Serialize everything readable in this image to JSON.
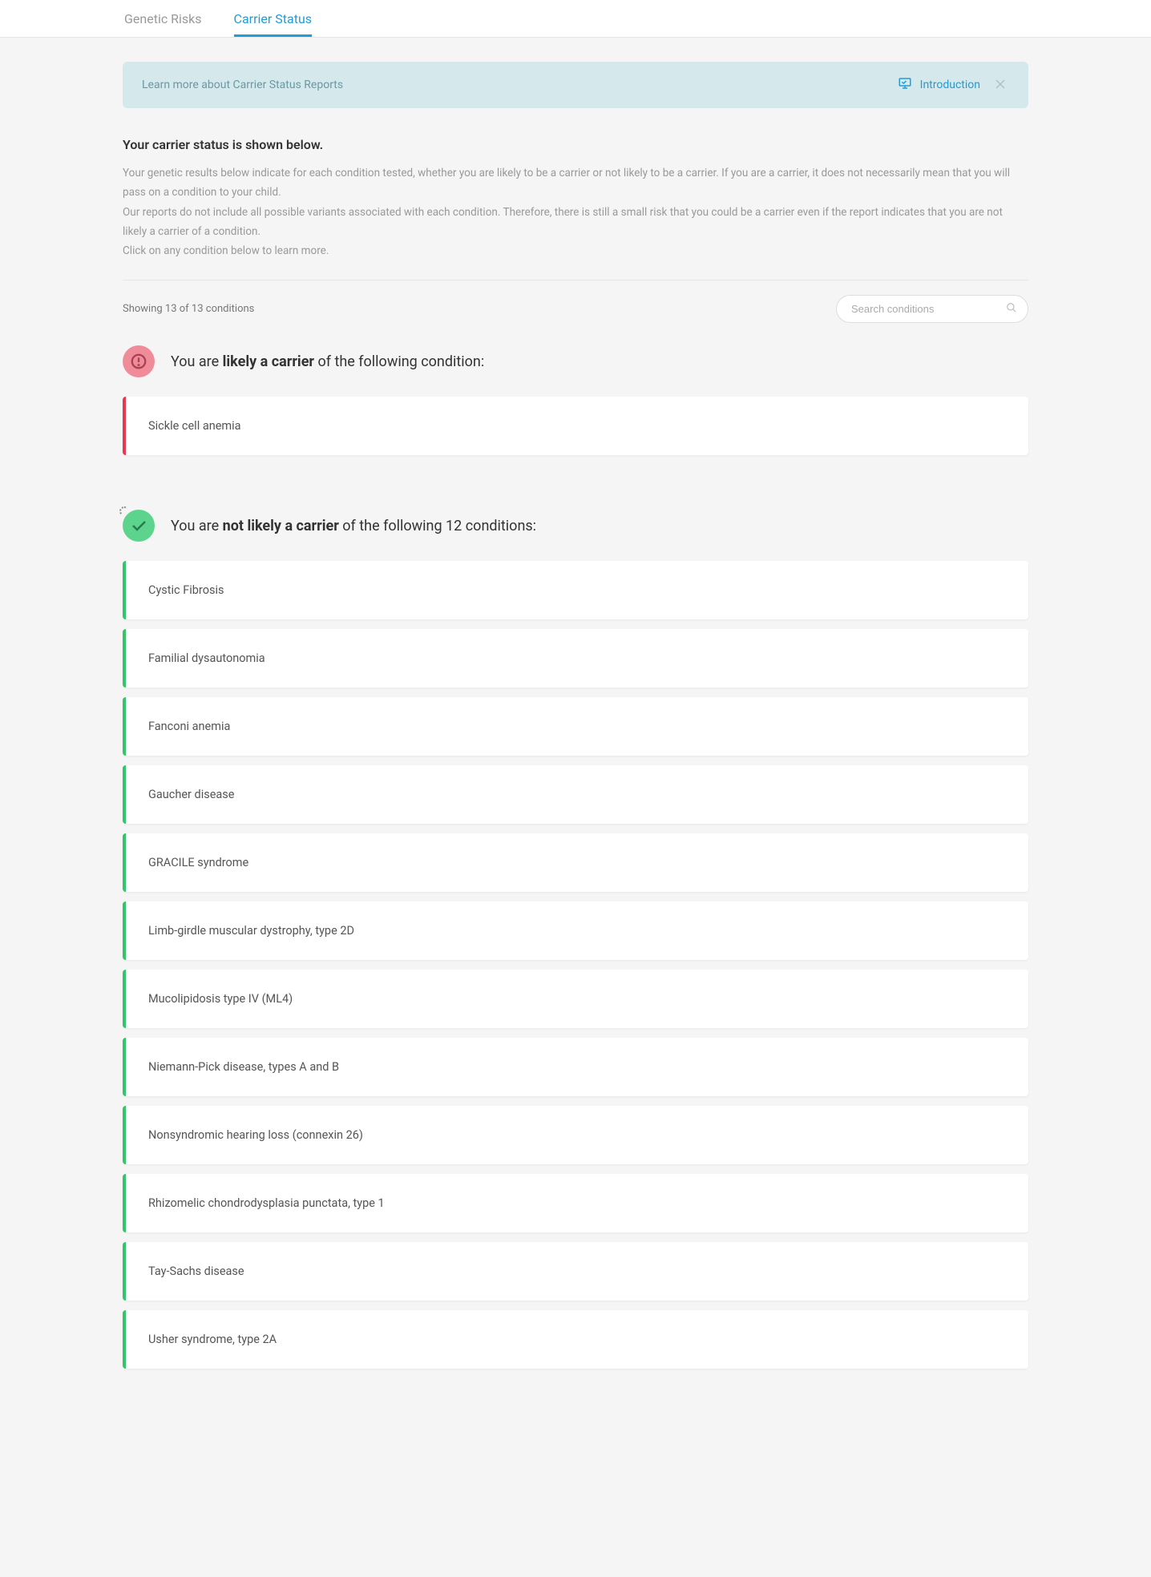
{
  "tabs": {
    "genetic_risks": "Genetic Risks",
    "carrier_status": "Carrier Status"
  },
  "banner": {
    "text": "Learn more about Carrier Status Reports",
    "intro_label": "Introduction"
  },
  "description": {
    "title": "Your carrier status is shown below.",
    "p1": "Your genetic results below indicate for each condition tested, whether you are likely to be a carrier or not likely to be a carrier. If you are a carrier, it does not necessarily mean that you will pass on a condition to your child.",
    "p2": "Our reports do not include all possible variants associated with each condition. Therefore, there is still a small risk that you could be a carrier even if the report indicates that you are not likely a carrier of a condition.",
    "p3": "Click on any condition below to learn more."
  },
  "list": {
    "count_text": "Showing 13 of 13 conditions",
    "search_placeholder": "Search conditions"
  },
  "section_likely": {
    "prefix": "You are ",
    "bold": "likely a carrier",
    "suffix": " of the following condition:"
  },
  "section_notlikely": {
    "prefix": "You are ",
    "bold": "not likely a carrier",
    "suffix": " of the following 12 conditions:"
  },
  "likely_conditions": [
    "Sickle cell anemia"
  ],
  "notlikely_conditions": [
    "Cystic Fibrosis",
    "Familial dysautonomia",
    "Fanconi anemia",
    "Gaucher disease",
    "GRACILE syndrome",
    "Limb-girdle muscular dystrophy, type 2D",
    "Mucolipidosis type IV (ML4)",
    "Niemann-Pick disease, types A and B",
    "Nonsyndromic hearing loss (connexin 26)",
    "Rhizomelic chondrodysplasia punctata, type 1",
    "Tay-Sachs disease",
    "Usher syndrome, type 2A"
  ]
}
